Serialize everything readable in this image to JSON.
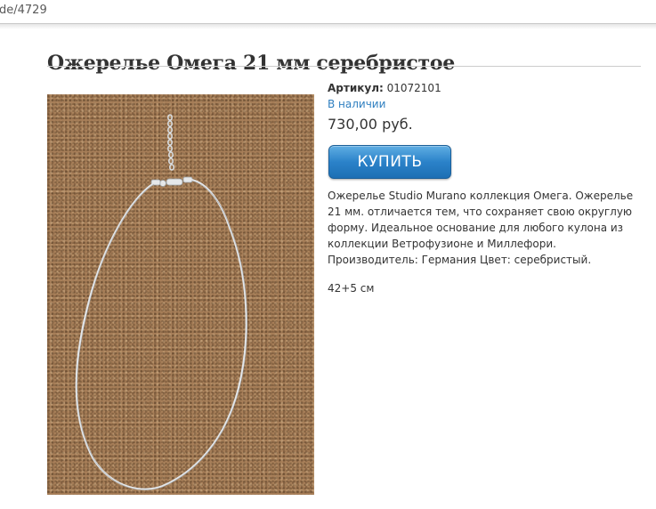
{
  "browser": {
    "url_fragment": "de/4729"
  },
  "product": {
    "title": "Ожерелье Омега 21 мм серебристое",
    "sku_label": "Артикул:",
    "sku_value": "01072101",
    "stock_status": "В наличии",
    "price": "730,00 руб.",
    "buy_label": "КУПИТЬ",
    "description": "Ожерелье Studio Murano коллекция Омега. Ожерелье 21 мм. отличается тем, что сохраняет свою округлую форму. Идеальное основание для любого кулона из коллекции Ветрофузионе и Миллефори. Производитель: Германия Цвет: серебристый.",
    "size": "42+5 см"
  },
  "colors": {
    "link_blue": "#2f7fc0",
    "button_blue": "#2b82c9",
    "cork_background": "#a87f59",
    "necklace_silver": "#d9dde0"
  },
  "icons": {
    "photo": "necklace-photo"
  }
}
